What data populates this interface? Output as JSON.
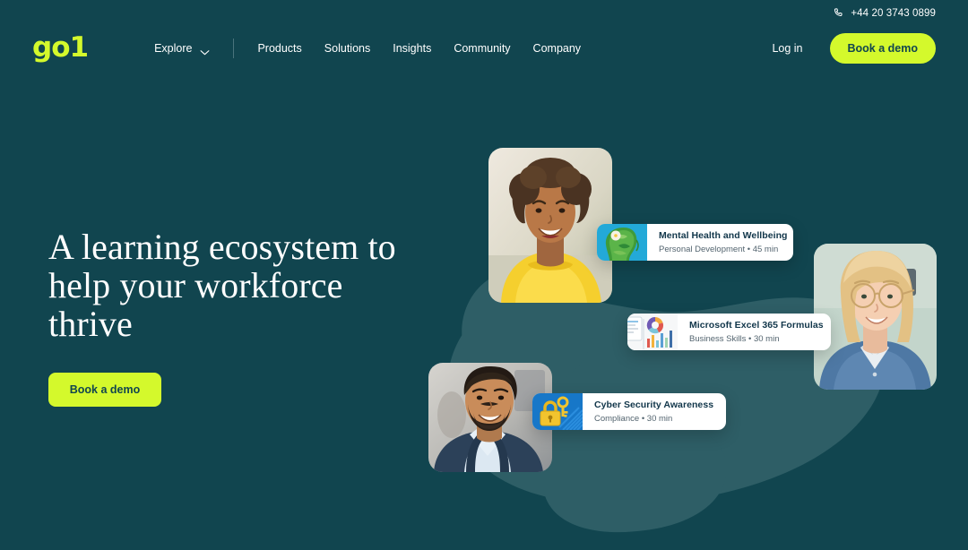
{
  "brand": {
    "logo_text": "go1",
    "accent_color": "#d4f92c",
    "background_color": "#11454f",
    "blob_color": "#2e5e66"
  },
  "utility_bar": {
    "phone_icon": "phone-icon",
    "phone_number": "+44 20 3743 0899"
  },
  "header": {
    "explore_label": "Explore",
    "chevron_icon": "chevron-down-icon",
    "nav_links": [
      {
        "label": "Products"
      },
      {
        "label": "Solutions"
      },
      {
        "label": "Insights"
      },
      {
        "label": "Community"
      },
      {
        "label": "Company"
      }
    ],
    "login_label": "Log in",
    "demo_label": "Book a demo"
  },
  "hero": {
    "title": "A learning ecosystem to help your workforce thrive",
    "cta_label": "Book a demo"
  },
  "collage": {
    "photos": [
      {
        "name": "photo-woman-yellow-sweater"
      },
      {
        "name": "photo-woman-glasses-denim"
      },
      {
        "name": "photo-man-blue-blazer"
      }
    ],
    "cards": [
      {
        "title": "Mental Health and Wellbeing",
        "category": "Personal Development",
        "duration": "45 min",
        "separator": "•",
        "icon": "headphones-icon",
        "thumbnail": "green-head-flower-thumbnail"
      },
      {
        "title": "Microsoft Excel 365 Formulas",
        "category": "Business Skills",
        "duration": "30 min",
        "separator": "•",
        "icon": "video-play-icon",
        "thumbnail": "charts-report-thumbnail"
      },
      {
        "title": "Cyber Security Awareness",
        "category": "Compliance",
        "duration": "30 min",
        "separator": "•",
        "icon": "document-icon",
        "thumbnail": "padlock-key-thumbnail"
      }
    ]
  }
}
